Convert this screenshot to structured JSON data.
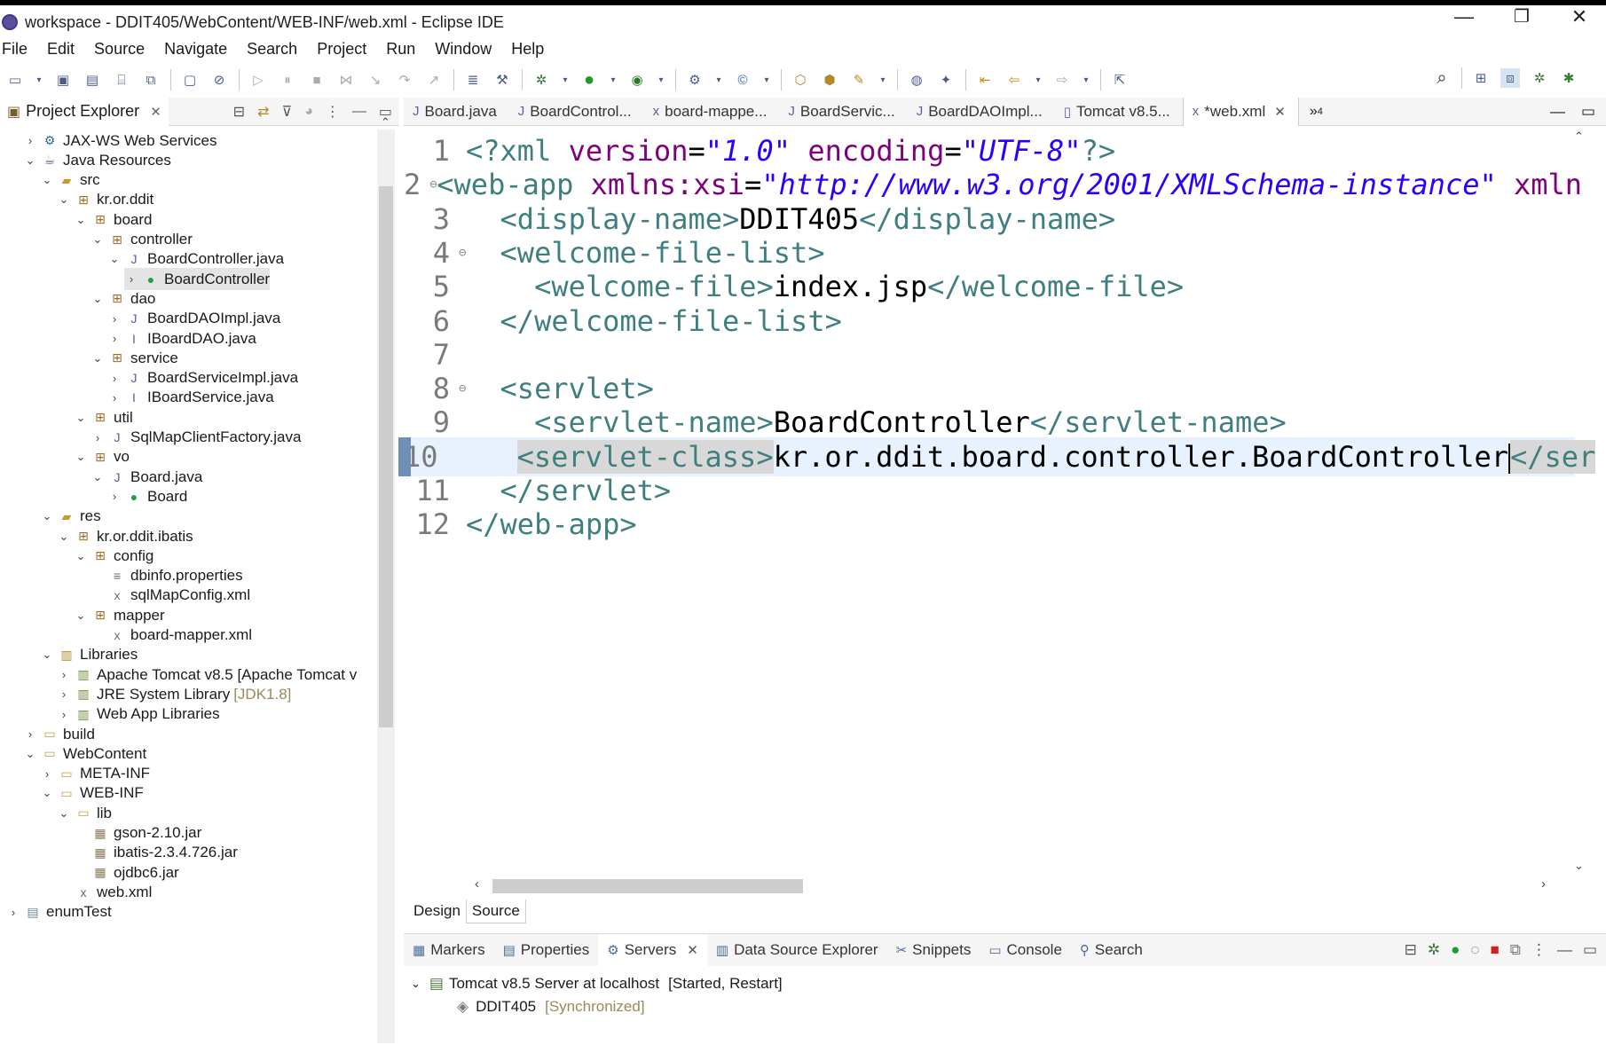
{
  "window": {
    "title": "workspace - DDIT405/WebContent/WEB-INF/web.xml - Eclipse IDE",
    "minimize": "—",
    "restore": "❐",
    "close": "✕"
  },
  "menu": [
    "File",
    "Edit",
    "Source",
    "Navigate",
    "Search",
    "Project",
    "Run",
    "Window",
    "Help"
  ],
  "explorer": {
    "tab_label": "Project Explorer",
    "tree": [
      {
        "label": "JAX-WS Web Services",
        "icon": "jaxws-icon",
        "twisty": "›"
      },
      {
        "label": "Java Resources",
        "icon": "java-resources-icon",
        "twisty": "⌄"
      },
      {
        "label": "src",
        "icon": "source-folder-icon",
        "twisty": "⌄"
      },
      {
        "label": "kr.or.ddit",
        "icon": "package-icon",
        "twisty": "⌄"
      },
      {
        "label": "board",
        "icon": "package-icon",
        "twisty": "⌄"
      },
      {
        "label": "controller",
        "icon": "package-icon",
        "twisty": "⌄"
      },
      {
        "label": "BoardController.java",
        "icon": "java-file-icon",
        "twisty": "⌄"
      },
      {
        "label": "BoardController",
        "icon": "class-icon",
        "twisty": "›"
      },
      {
        "label": "dao",
        "icon": "package-icon",
        "twisty": "⌄"
      },
      {
        "label": "BoardDAOImpl.java",
        "icon": "java-file-icon",
        "twisty": "›"
      },
      {
        "label": "IBoardDAO.java",
        "icon": "java-interface-file-icon",
        "twisty": "›"
      },
      {
        "label": "service",
        "icon": "package-icon",
        "twisty": "⌄"
      },
      {
        "label": "BoardServiceImpl.java",
        "icon": "java-file-icon",
        "twisty": "›"
      },
      {
        "label": "IBoardService.java",
        "icon": "java-interface-file-icon",
        "twisty": "›"
      },
      {
        "label": "util",
        "icon": "package-icon",
        "twisty": "⌄"
      },
      {
        "label": "SqlMapClientFactory.java",
        "icon": "java-file-icon",
        "twisty": "›"
      },
      {
        "label": "vo",
        "icon": "package-icon",
        "twisty": "⌄"
      },
      {
        "label": "Board.java",
        "icon": "java-file-icon",
        "twisty": "⌄"
      },
      {
        "label": "Board",
        "icon": "class-icon",
        "twisty": "›"
      },
      {
        "label": "res",
        "icon": "source-folder-icon",
        "twisty": "⌄"
      },
      {
        "label": "kr.or.ddit.ibatis",
        "icon": "package-icon",
        "twisty": "⌄"
      },
      {
        "label": "config",
        "icon": "package-icon",
        "twisty": "⌄"
      },
      {
        "label": "dbinfo.properties",
        "icon": "properties-file-icon",
        "twisty": ""
      },
      {
        "label": "sqlMapConfig.xml",
        "icon": "xml-file-icon",
        "twisty": ""
      },
      {
        "label": "mapper",
        "icon": "package-icon",
        "twisty": "⌄"
      },
      {
        "label": "board-mapper.xml",
        "icon": "xml-file-icon",
        "twisty": ""
      },
      {
        "label": "Libraries",
        "icon": "libraries-icon",
        "twisty": "⌄"
      },
      {
        "label": "Apache Tomcat v8.5 [Apache Tomcat v",
        "icon": "library-icon",
        "twisty": "›"
      },
      {
        "label": "JRE System Library",
        "icon": "library-icon",
        "twisty": "›",
        "decoration": "[JDK1.8]"
      },
      {
        "label": "Web App Libraries",
        "icon": "library-icon",
        "twisty": "›"
      },
      {
        "label": "build",
        "icon": "folder-icon",
        "twisty": "›"
      },
      {
        "label": "WebContent",
        "icon": "folder-icon",
        "twisty": "⌄"
      },
      {
        "label": "META-INF",
        "icon": "folder-icon",
        "twisty": "›"
      },
      {
        "label": "WEB-INF",
        "icon": "folder-icon",
        "twisty": "⌄"
      },
      {
        "label": "lib",
        "icon": "folder-icon",
        "twisty": "⌄"
      },
      {
        "label": "gson-2.10.jar",
        "icon": "jar-icon",
        "twisty": ""
      },
      {
        "label": "ibatis-2.3.4.726.jar",
        "icon": "jar-icon",
        "twisty": ""
      },
      {
        "label": "ojdbc6.jar",
        "icon": "jar-icon",
        "twisty": ""
      },
      {
        "label": "web.xml",
        "icon": "xml-file-icon",
        "twisty": ""
      },
      {
        "label": "enumTest",
        "icon": "project-icon",
        "twisty": "›"
      }
    ]
  },
  "editor": {
    "tabs": [
      {
        "label": "Board.java",
        "icon": "java-file-icon"
      },
      {
        "label": "BoardControl...",
        "icon": "java-file-icon"
      },
      {
        "label": "board-mappe...",
        "icon": "xml-file-icon"
      },
      {
        "label": "BoardServic...",
        "icon": "java-file-icon"
      },
      {
        "label": "BoardDAOImpl...",
        "icon": "java-file-icon"
      },
      {
        "label": "Tomcat v8.5...",
        "icon": "server-icon"
      },
      {
        "label": "*web.xml",
        "icon": "xml-file-icon",
        "active": true
      }
    ],
    "overflow_count": "4",
    "current_line": 10,
    "lines": [
      {
        "n": "1",
        "fold": "",
        "parts": [
          [
            "tag",
            "<?"
          ],
          [
            "tag",
            "xml "
          ],
          [
            "attr",
            "version"
          ],
          [
            "txtc",
            "="
          ],
          [
            "str",
            "\"1.0\""
          ],
          [
            "txtc",
            " "
          ],
          [
            "attr",
            "encoding"
          ],
          [
            "txtc",
            "="
          ],
          [
            "str",
            "\"UTF-8\""
          ],
          [
            "tag",
            "?>"
          ]
        ]
      },
      {
        "n": "2",
        "fold": "⊖",
        "parts": [
          [
            "tag",
            "<web-app "
          ],
          [
            "attr",
            "xmlns:xsi"
          ],
          [
            "txtc",
            "="
          ],
          [
            "str",
            "\"http://www.w3.org/2001/XMLSchema-instance\""
          ],
          [
            "txtc",
            " "
          ],
          [
            "attr",
            "xmln"
          ]
        ]
      },
      {
        "n": "3",
        "fold": "",
        "parts": [
          [
            "txtc",
            "  "
          ],
          [
            "tag",
            "<display-name>"
          ],
          [
            "txtc",
            "DDIT405"
          ],
          [
            "tag",
            "</display-name>"
          ]
        ]
      },
      {
        "n": "4",
        "fold": "⊖",
        "parts": [
          [
            "txtc",
            "  "
          ],
          [
            "tag",
            "<welcome-file-list>"
          ]
        ]
      },
      {
        "n": "5",
        "fold": "",
        "parts": [
          [
            "txtc",
            "    "
          ],
          [
            "tag",
            "<welcome-file>"
          ],
          [
            "txtc",
            "index.jsp"
          ],
          [
            "tag",
            "</welcome-file>"
          ]
        ]
      },
      {
        "n": "6",
        "fold": "",
        "parts": [
          [
            "txtc",
            "  "
          ],
          [
            "tag",
            "</welcome-file-list>"
          ]
        ]
      },
      {
        "n": "7",
        "fold": "",
        "parts": []
      },
      {
        "n": "8",
        "fold": "⊖",
        "parts": [
          [
            "txtc",
            "  "
          ],
          [
            "tag",
            "<servlet>"
          ]
        ]
      },
      {
        "n": "9",
        "fold": "",
        "parts": [
          [
            "txtc",
            "    "
          ],
          [
            "tag",
            "<servlet-name>"
          ],
          [
            "txtc",
            "BoardController"
          ],
          [
            "tag",
            "</servlet-name>"
          ]
        ]
      },
      {
        "n": "10",
        "fold": "",
        "parts": [
          [
            "txtc",
            "    "
          ],
          [
            "tagsel",
            "<servlet-class>"
          ],
          [
            "txtc",
            "kr.or.ddit.board.controller.BoardController"
          ],
          [
            "tagsel",
            "</ser"
          ]
        ]
      },
      {
        "n": "11",
        "fold": "",
        "parts": [
          [
            "txtc",
            "  "
          ],
          [
            "tag",
            "</servlet>"
          ]
        ]
      },
      {
        "n": "12",
        "fold": "",
        "parts": [
          [
            "tag",
            "</web-app>"
          ]
        ]
      }
    ],
    "mode_tabs": [
      "Design",
      "Source"
    ]
  },
  "bottom_panel": {
    "tabs": [
      {
        "label": "Markers",
        "icon": "markers-icon"
      },
      {
        "label": "Properties",
        "icon": "properties-icon"
      },
      {
        "label": "Servers",
        "icon": "servers-icon",
        "active": true
      },
      {
        "label": "Data Source Explorer",
        "icon": "data-source-icon"
      },
      {
        "label": "Snippets",
        "icon": "snippets-icon"
      },
      {
        "label": "Console",
        "icon": "console-icon"
      },
      {
        "label": "Search",
        "icon": "search-icon"
      }
    ],
    "server": {
      "label": "Tomcat v8.5 Server at localhost",
      "state": "[Started, Restart]"
    },
    "module": {
      "label": "DDIT405",
      "state": "[Synchronized]"
    }
  },
  "colors": {
    "tag": "#3f7f7f",
    "attr": "#7f007f",
    "string": "#2a00ff",
    "current_line": "#e8f2fe"
  }
}
